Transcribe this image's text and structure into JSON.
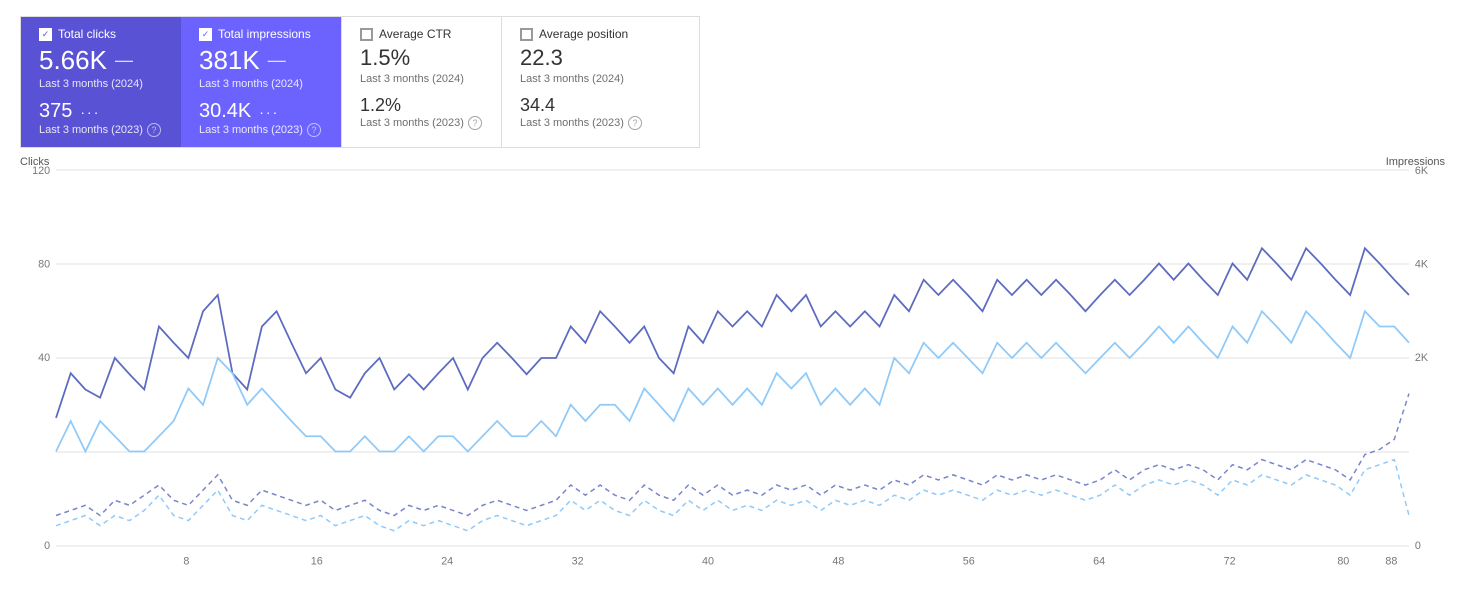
{
  "metrics": [
    {
      "id": "total-clicks",
      "label": "Total clicks",
      "checked": true,
      "style": "active-blue",
      "main_value": "5.66K",
      "main_period": "Last 3 months (2024)",
      "secondary_value": "375",
      "secondary_indicator": "···",
      "secondary_period": "Last 3 months (2023)",
      "show_help": true
    },
    {
      "id": "total-impressions",
      "label": "Total impressions",
      "checked": true,
      "style": "active-purple",
      "main_value": "381K",
      "main_period": "Last 3 months (2024)",
      "secondary_value": "30.4K",
      "secondary_indicator": "···",
      "secondary_period": "Last 3 months (2023)",
      "show_help": true
    },
    {
      "id": "average-ctr",
      "label": "Average CTR",
      "checked": false,
      "style": "inactive",
      "main_value": "1.5%",
      "main_period": "Last 3 months (2024)",
      "secondary_value": "1.2%",
      "secondary_indicator": "",
      "secondary_period": "Last 3 months (2023)",
      "show_help": true
    },
    {
      "id": "average-position",
      "label": "Average position",
      "checked": false,
      "style": "inactive",
      "main_value": "22.3",
      "main_period": "Last 3 months (2024)",
      "secondary_value": "34.4",
      "secondary_indicator": "",
      "secondary_period": "Last 3 months (2023)",
      "show_help": true
    }
  ],
  "chart": {
    "left_axis_label": "Clicks",
    "right_axis_label": "Impressions",
    "left_y_ticks": [
      "120",
      "80",
      "40",
      "0"
    ],
    "right_y_ticks": [
      "6K",
      "4K",
      "2K",
      "0"
    ],
    "x_ticks": [
      "8",
      "16",
      "24",
      "32",
      "40",
      "48",
      "56",
      "64",
      "72",
      "80",
      "88"
    ]
  }
}
